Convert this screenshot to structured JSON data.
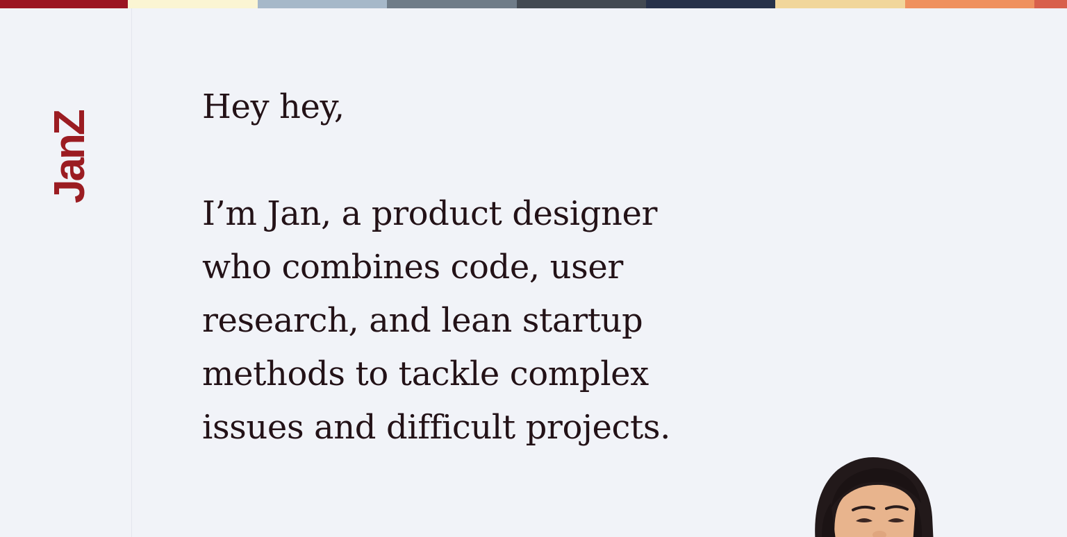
{
  "brand": {
    "logo_text": "JanZ",
    "logo_color": "#9b1c22"
  },
  "strip_colors": [
    "#9b1522",
    "#fbf5d3",
    "#a6b8c9",
    "#6f7c88",
    "#434a52",
    "#27324a",
    "#f1d69b",
    "#ef915f",
    "#d8604c"
  ],
  "intro": {
    "greeting": "Hey hey,",
    "lines": [
      "I’m Jan, a product designer",
      "who combines code, user",
      "research, and lean startup",
      "methods to tackle complex",
      "issues and difficult projects."
    ]
  },
  "colors": {
    "background": "#f1f3f8",
    "text": "#231217"
  }
}
